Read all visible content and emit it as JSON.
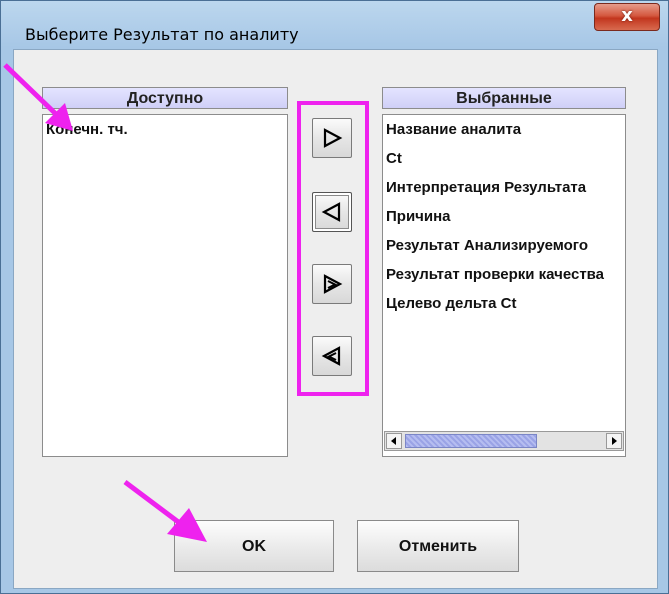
{
  "window": {
    "title": "Выберите Результат по аналиту",
    "close_label": "x"
  },
  "available": {
    "header": "Доступно",
    "items": [
      "Конечн. тч."
    ]
  },
  "selected": {
    "header": "Выбранные",
    "items": [
      "Название аналита",
      "Ct",
      "Интерпретация Результата",
      "Причина",
      "Результат Анализируемого",
      "Результат проверки качества",
      "Целево дельта Ct"
    ]
  },
  "transfer_buttons": [
    {
      "icon": "move-right-icon"
    },
    {
      "icon": "move-left-icon"
    },
    {
      "icon": "move-all-right-icon"
    },
    {
      "icon": "move-all-left-icon"
    }
  ],
  "buttons": {
    "ok": "OK",
    "cancel": "Отменить"
  },
  "colors": {
    "annotation": "#ee22ee",
    "header_bg": "#cfcff7",
    "close_red": "#c2361e"
  }
}
